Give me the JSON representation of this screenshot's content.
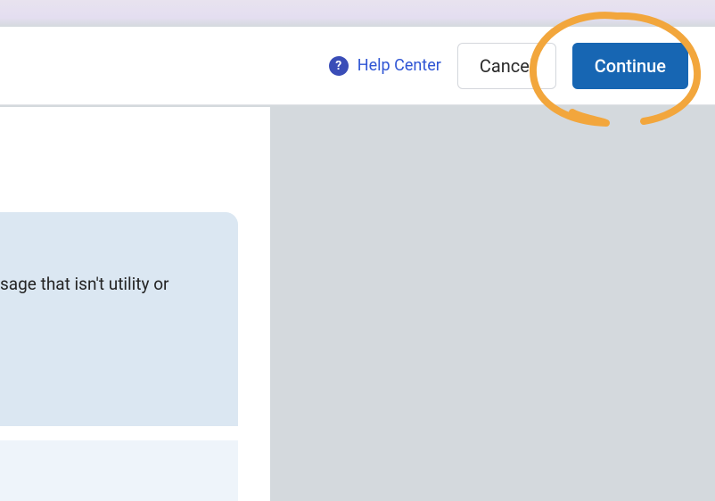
{
  "header": {
    "help_label": "Help Center",
    "cancel_label": "Cancel",
    "continue_label": "Continue",
    "help_glyph": "?"
  },
  "card": {
    "fragment_text": "sage that isn't utility or"
  },
  "colors": {
    "primary": "#1766b3",
    "link": "#2f55d4",
    "annotation": "#f2a63c"
  }
}
